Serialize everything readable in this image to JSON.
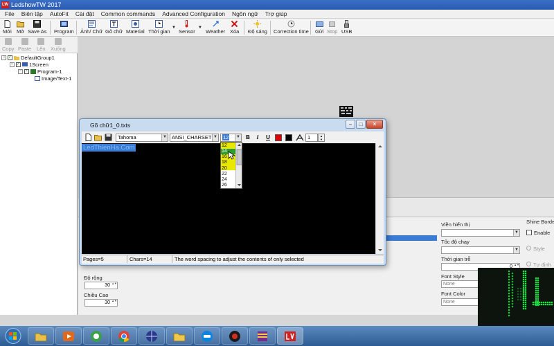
{
  "window": {
    "title": "LedshowTW 2017",
    "app_icon": "LW"
  },
  "menu": [
    "File",
    "Biên tập",
    "AutoFit",
    "Cài đặt",
    "Common commands",
    "Advanced Configuration",
    "Ngôn ngữ",
    "Trợ giúp"
  ],
  "toolbar": {
    "new": "Mới",
    "open": "Mở",
    "save_as": "Save As",
    "program": "Program",
    "image_text": "Ảnh/ Chữ",
    "type_text": "Gõ chữ",
    "material": "Material",
    "time": "Thời gian",
    "sensor": "Sensor",
    "weather": "Weather",
    "delete": "Xóa",
    "brightness": "Độ sáng",
    "correction_time": "Correction time",
    "send": "Gửi",
    "stop": "Stop",
    "usb": "USB"
  },
  "left_tools": {
    "copy": "Copy",
    "paste": "Paste",
    "up": "Lên",
    "down": "Xuống"
  },
  "tree": {
    "group": "DefaultGroup1",
    "screen": "1Screen",
    "program": "Program-1",
    "item": "Image/Text-1"
  },
  "properties": {
    "width_label": "Độ rộng",
    "width_value": "30",
    "height_label": "Chiều Cao",
    "height_value": "30",
    "display_label": "Viền hiển thị",
    "speed_label": "Tốc độ chạy",
    "delay_label": "Thời gian trễ",
    "delay_value": "0",
    "font_style_label": "Font Style",
    "font_style_value": "None",
    "font_color_label": "Font Color",
    "font_color_value": "None",
    "shine_border_label": "Shine Border",
    "enable_label": "Enable",
    "style_label": "Style",
    "effect_label": "Tự định"
  },
  "dialog": {
    "title": "Gõ chữ1_0.txts",
    "font": "Tahoma",
    "charset": "ANSI_CHARSET",
    "size_selected": "12",
    "bold": "B",
    "italic": "I",
    "underline": "U",
    "spacing": "1",
    "text": "LedThienHa.Com",
    "size_options": [
      "12",
      "14",
      "16",
      "18",
      "20",
      "22",
      "24",
      "26"
    ],
    "size_highlighted": "14",
    "status_pages": "Pages=5",
    "status_chars": "Chars=14",
    "status_hint": "The word spacing to adjust the contents of only selected"
  },
  "colors": {
    "title_bar": "#2a5bb0",
    "selection": "#3b7bd6",
    "highlight_list": "#e8e800",
    "selected_item": "#2f9d2f",
    "editor_bg": "#000000",
    "text_color_swatch": "#e00000",
    "bg_color_swatch": "#000000",
    "led_green": "#22dd44",
    "led_red": "#ff3322"
  }
}
